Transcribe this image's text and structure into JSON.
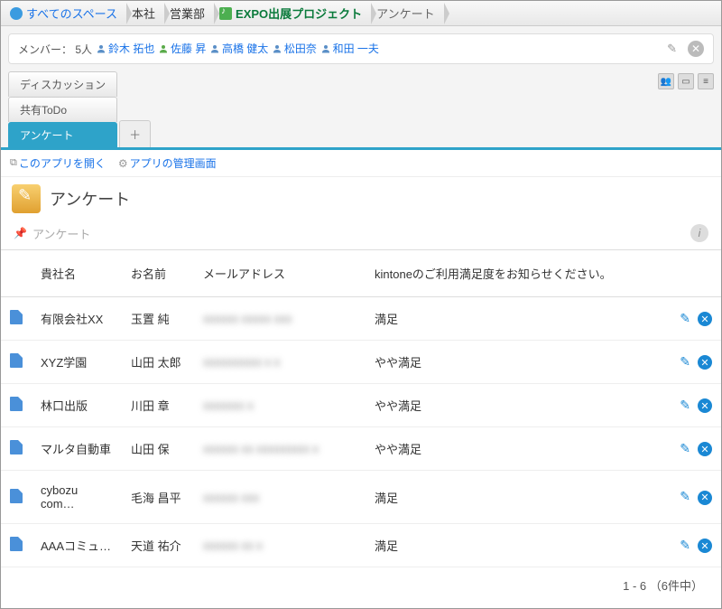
{
  "breadcrumb": {
    "all_spaces": "すべてのスペース",
    "org1": "本社",
    "org2": "営業部",
    "project": "EXPO出展プロジェクト",
    "current": "アンケート"
  },
  "members": {
    "label": "メンバー： 5人",
    "list": [
      {
        "name": "鈴木 拓也",
        "color": "blue"
      },
      {
        "name": "佐藤 昇",
        "color": "green"
      },
      {
        "name": "高橋 健太",
        "color": "blue"
      },
      {
        "name": "松田奈",
        "color": "blue"
      },
      {
        "name": "和田 一夫",
        "color": "blue"
      }
    ]
  },
  "tabs": {
    "items": [
      "ディスカッション",
      "共有ToDo",
      "アンケート"
    ],
    "active_index": 2,
    "add": "＋"
  },
  "applinks": {
    "open": "このアプリを開く",
    "admin": "アプリの管理画面"
  },
  "app": {
    "title": "アンケート",
    "filter_label": "アンケート"
  },
  "table": {
    "headers": {
      "company": "貴社名",
      "name": "お名前",
      "email": "メールアドレス",
      "satisfaction": "kintoneのご利用満足度をお知らせください。"
    },
    "rows": [
      {
        "company": "有限会社XX",
        "name": "玉置 純",
        "email": "xxxxxx xxxxx xxx",
        "satisfaction": "満足"
      },
      {
        "company": "XYZ学園",
        "name": "山田 太郎",
        "email": "xxxxxxxxxx x x",
        "satisfaction": "やや満足"
      },
      {
        "company": "林口出版",
        "name": "川田 章",
        "email": "xxxxxxx x",
        "satisfaction": "やや満足"
      },
      {
        "company": "マルタ自動車",
        "name": "山田 保",
        "email": "xxxxxx xx xxxxxxxxx x",
        "satisfaction": "やや満足"
      },
      {
        "company": "cybozu com…",
        "name": "毛海 昌平",
        "email": "xxxxxx xxx",
        "satisfaction": "満足"
      },
      {
        "company": "AAAコミュ…",
        "name": "天道 祐介",
        "email": "xxxxxx xx x",
        "satisfaction": "満足"
      }
    ]
  },
  "pager": "1 - 6 （6件中）"
}
